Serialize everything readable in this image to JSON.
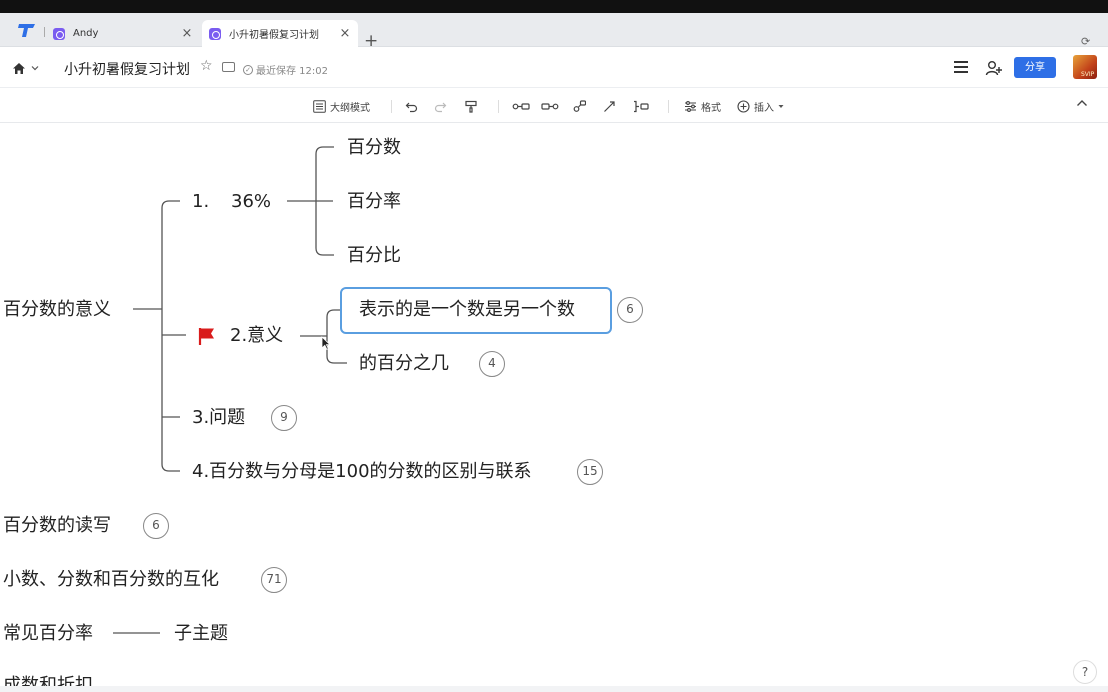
{
  "browser": {
    "tabs": [
      {
        "title": "Andy"
      },
      {
        "title": "小升初暑假复习计划"
      }
    ],
    "close_glyph": "×",
    "new_tab_glyph": "+"
  },
  "header": {
    "doc_title": "小升初暑假复习计划",
    "save_status": "最近保存 12:02",
    "share_label": "分享"
  },
  "toolbar": {
    "outline_mode": "大纲模式",
    "format": "格式",
    "insert": "插入"
  },
  "mindmap": {
    "root": "百分数的意义",
    "branch1": {
      "label": "1.",
      "value": "36%",
      "children": [
        "百分数",
        "百分率",
        "百分比"
      ]
    },
    "branch2": {
      "label": "2.意义",
      "children": [
        {
          "text": "表示的是一个数是另一个数",
          "count": "6"
        },
        {
          "text": "的百分之几",
          "count": "4"
        }
      ]
    },
    "branch3": {
      "label": "3.问题",
      "count": "9"
    },
    "branch4": {
      "label": "4.百分数与分母是100的分数的区别与联系",
      "count": "15"
    },
    "topics": [
      {
        "label": "百分数的读写",
        "count": "6"
      },
      {
        "label": "小数、分数和百分数的互化",
        "count": "71"
      },
      {
        "label": "常见百分率",
        "child": "子主题"
      },
      {
        "label": "成数和折扣"
      }
    ]
  },
  "colors": {
    "accent": "#2e6fe6",
    "selection": "#5a9ee0",
    "flag": "#d91c1c"
  },
  "help_label": "?"
}
